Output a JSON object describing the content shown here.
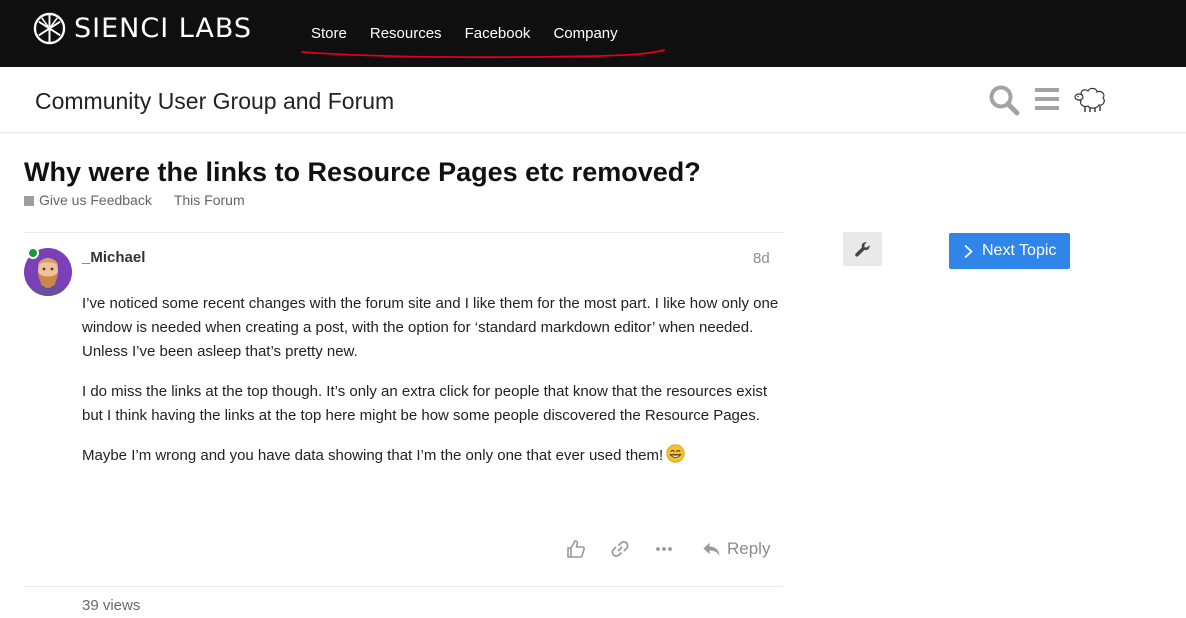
{
  "brand": {
    "name": "SIENCI LABS",
    "icon": "sienci-logo-icon"
  },
  "nav": {
    "items": [
      {
        "label": "Store"
      },
      {
        "label": "Resources"
      },
      {
        "label": "Facebook"
      },
      {
        "label": "Company"
      }
    ],
    "underline_color": "#e0001b"
  },
  "forum": {
    "title": "Community User Group and Forum",
    "icons": [
      "search-icon",
      "hamburger-menu-icon",
      "sheep-avatar-icon"
    ]
  },
  "topic": {
    "title": "Why were the links to Resource Pages etc removed?",
    "categories": [
      {
        "label": "Give us Feedback",
        "color": "#9e9e9e"
      },
      {
        "label": "This Forum"
      }
    ]
  },
  "post": {
    "username": "_Michael",
    "date": "8d",
    "paragraphs": [
      "I’ve noticed some recent changes with the forum site and I like them for the most part. I like how only one window is needed when creating a post, with the option for ‘standard markdown editor’ when needed. Unless I’ve been asleep that’s pretty new.",
      "I do miss the links at the top though. It’s only an extra click for people that know that the resources exist but I think having the links at the top here might be how some people discovered the Resource Pages.",
      "Maybe I’m wrong and you have data showing that I’m the only one that ever used them!"
    ],
    "emoji": "grinning-face-emoji",
    "actions": {
      "reply_label": "Reply"
    },
    "views": "39 views"
  },
  "timeline": {
    "next_topic_label": "Next Topic"
  },
  "colors": {
    "topbar": "#0f0f0f",
    "accent": "#2f86e8",
    "online": "#1a9a38"
  }
}
